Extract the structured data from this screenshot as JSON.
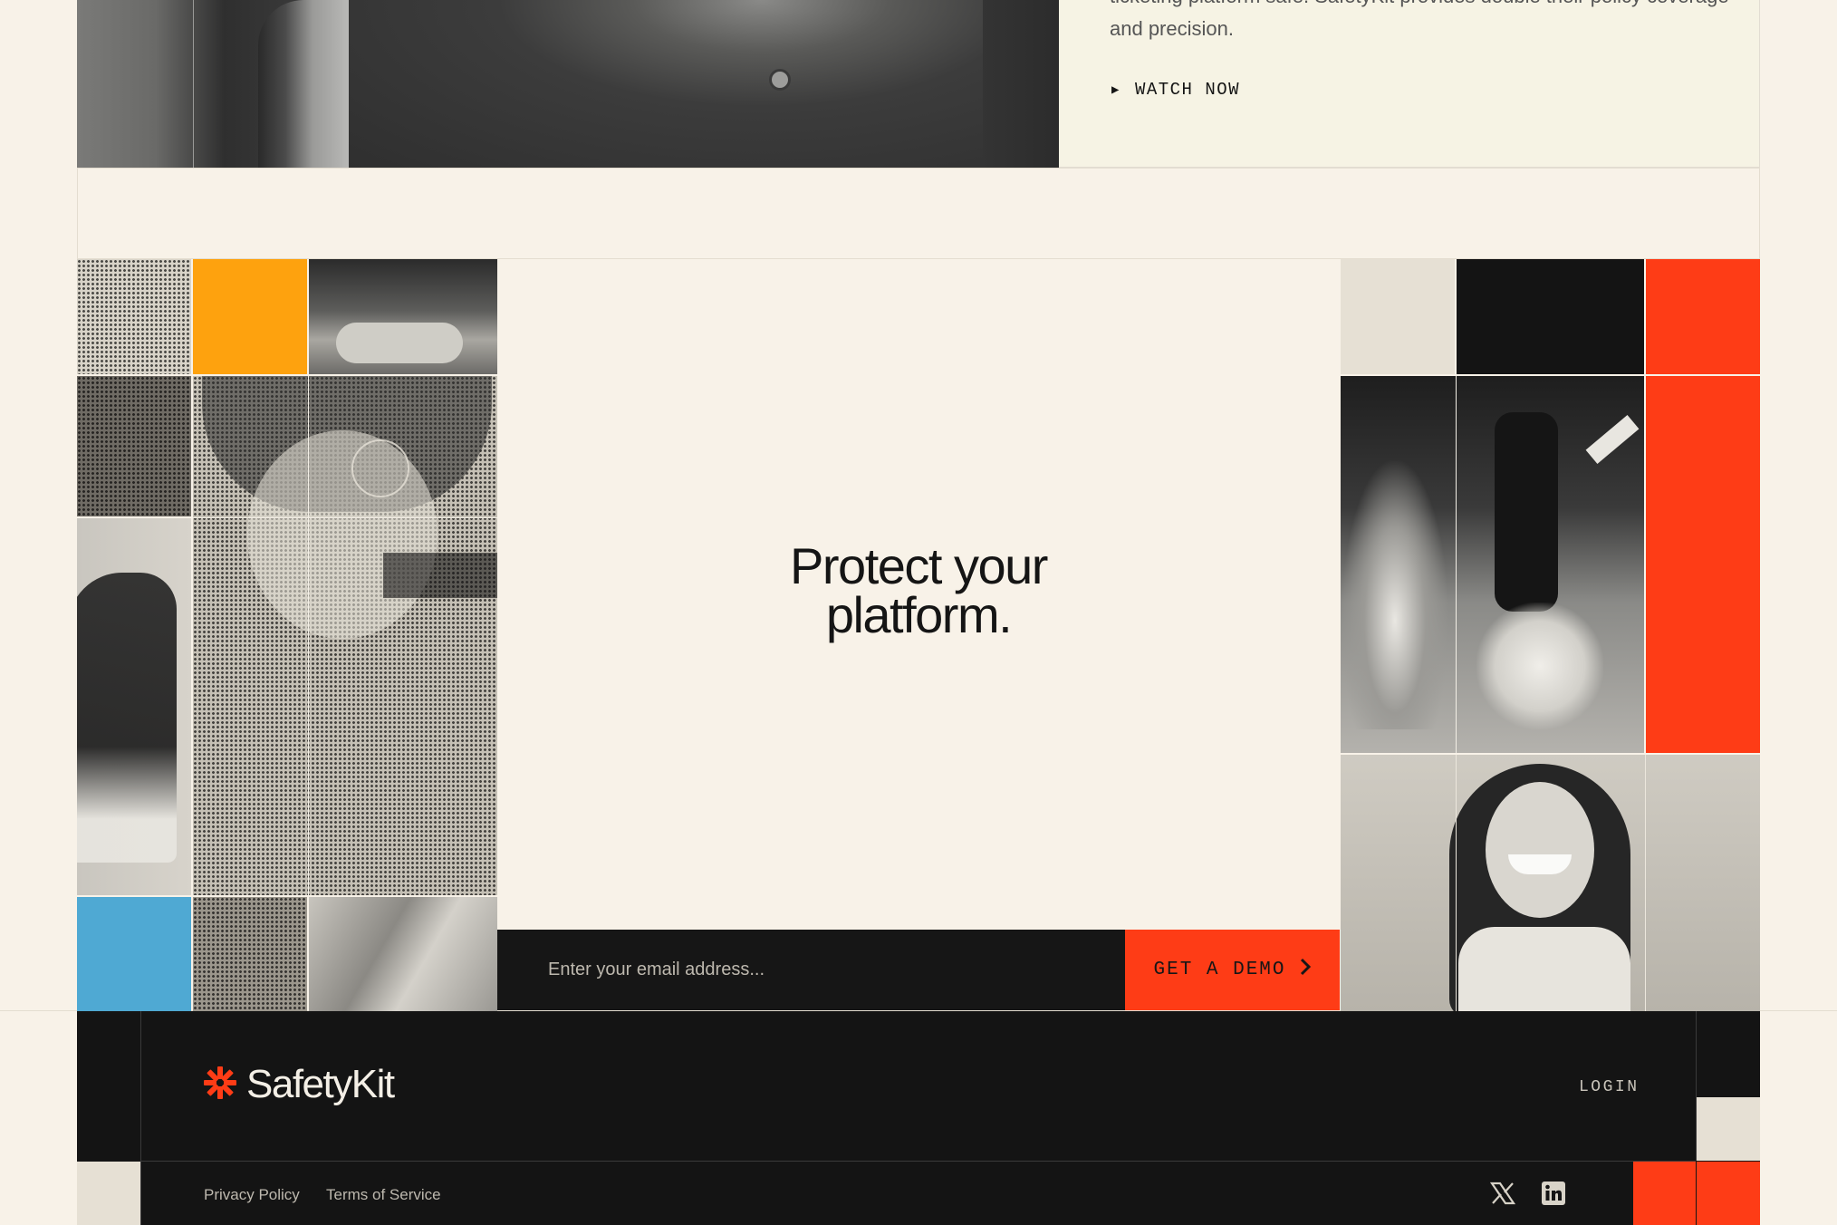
{
  "testimonial": {
    "quote_partial": "ticketing platform safe. SafetyKit provides double their policy coverage and precision.",
    "watch_label": "WATCH NOW"
  },
  "cta": {
    "heading_line1": "Protect your",
    "heading_line2": "platform.",
    "email_placeholder": "Enter your email address...",
    "button_label": "GET A DEMO"
  },
  "footer": {
    "brand": "SafetyKit",
    "login_label": "LOGIN",
    "links": [
      "Privacy Policy",
      "Terms of Service"
    ],
    "social": [
      "x-icon",
      "linkedin-icon"
    ]
  },
  "colors": {
    "background": "#f8f2e8",
    "accent_red": "#fe3c16",
    "accent_orange": "#fea20e",
    "accent_blue": "#4fa9d3",
    "dark": "#141414"
  }
}
